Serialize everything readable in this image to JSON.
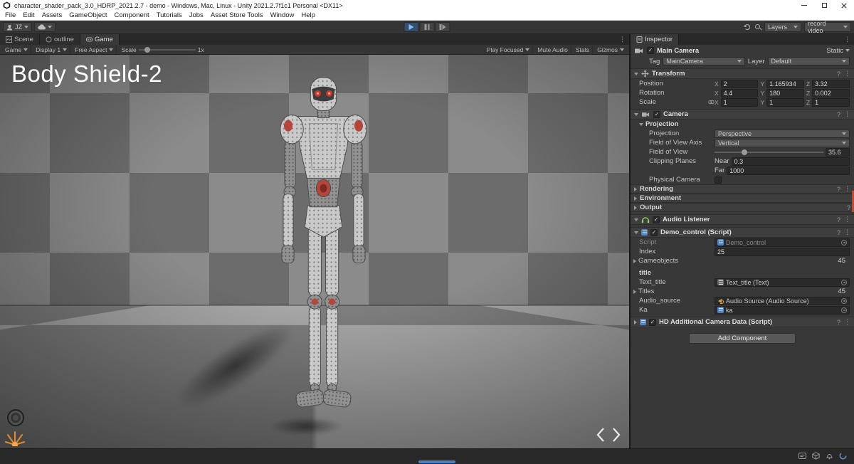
{
  "window": {
    "title": "character_shader_pack_3.0_HDRP_2021.2.7 - demo - Windows, Mac, Linux - Unity 2021.2.7f1c1 Personal <DX11>"
  },
  "menu": {
    "items": [
      "File",
      "Edit",
      "Assets",
      "GameObject",
      "Component",
      "Tutorials",
      "Jobs",
      "Asset Store Tools",
      "Window",
      "Help"
    ]
  },
  "toolbar": {
    "account_label": "JZ",
    "layers_label": "Layers",
    "layout_label": "record video"
  },
  "tabs": {
    "scene": "Scene",
    "outline": "outline",
    "game": "Game",
    "inspector": "Inspector"
  },
  "game_toolbar": {
    "display_menu": "Game",
    "display": "Display 1",
    "aspect": "Free Aspect",
    "scale_label": "Scale",
    "scale_value": "1x",
    "play_focused": "Play Focused",
    "mute_audio": "Mute Audio",
    "stats": "Stats",
    "gizmos": "Gizmos"
  },
  "game_view": {
    "overlay_title": "Body Shield-2"
  },
  "inspector": {
    "header": {
      "name": "Main Camera",
      "static_label": "Static"
    },
    "tag_row": {
      "tag_label": "Tag",
      "tag_value": "MainCamera",
      "layer_label": "Layer",
      "layer_value": "Default"
    },
    "axis": {
      "x": "X",
      "y": "Y",
      "z": "Z"
    },
    "transform": {
      "title": "Transform",
      "rows": [
        {
          "label": "Position",
          "x": "2",
          "y": "1.165934",
          "z": "3.32"
        },
        {
          "label": "Rotation",
          "x": "4.4",
          "y": "180",
          "z": "0.002"
        },
        {
          "label": "Scale",
          "x": "1",
          "y": "1",
          "z": "1"
        }
      ]
    },
    "camera": {
      "title": "Camera",
      "section": "Projection",
      "projection_label": "Projection",
      "projection_value": "Perspective",
      "fov_axis_label": "Field of View Axis",
      "fov_axis_value": "Vertical",
      "fov_label": "Field of View",
      "fov_value": "35.6",
      "clipping_label": "Clipping Planes",
      "near_label": "Near",
      "near_value": "0.3",
      "far_label": "Far",
      "far_value": "1000",
      "physical_label": "Physical Camera",
      "foldouts": [
        "Rendering",
        "Environment",
        "Output"
      ]
    },
    "audio_listener": {
      "title": "Audio Listener"
    },
    "demo_control": {
      "title": "Demo_control (Script)",
      "script_label": "Script",
      "script_value": "Demo_control",
      "index_label": "Index",
      "index_value": "25",
      "gameobjects_label": "Gameobjects",
      "gameobjects_value": "45",
      "section_label": "title",
      "text_title_label": "Text_title",
      "text_title_value": "Text_title (Text)",
      "titles_label": "Titles",
      "titles_value": "45",
      "audio_source_label": "Audio_source",
      "audio_source_value": "Audio Source (Audio Source)",
      "ka_label": "Ka",
      "ka_value": "ka"
    },
    "hd_data": {
      "title": "HD Additional Camera Data (Script)"
    },
    "add_component_label": "Add Component"
  },
  "icons": {
    "check": "✓",
    "menu": "⋮",
    "help": "?"
  }
}
